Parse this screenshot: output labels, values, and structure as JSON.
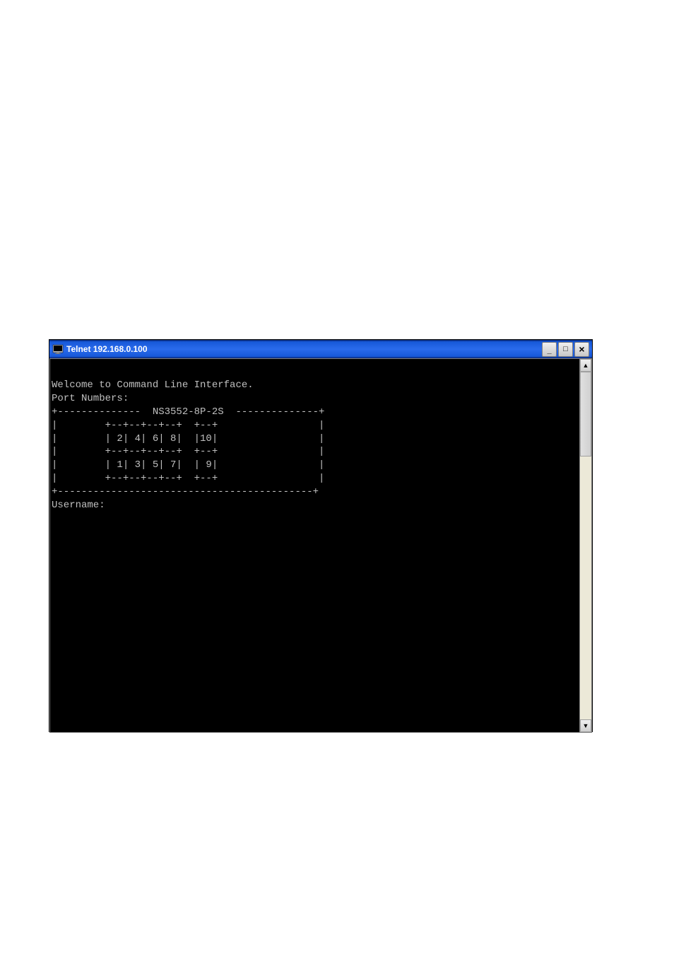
{
  "window": {
    "title": "Telnet 192.168.0.100",
    "controls": {
      "minimize": "─",
      "maximize": "□",
      "close": "×"
    }
  },
  "terminal": {
    "line1": "Welcome to Command Line Interface.",
    "line2": "Port Numbers:",
    "line3": "",
    "line4": "+--------------  NS3552-8P-2S  --------------+",
    "line5": "|        +--+--+--+--+  +--+                 |",
    "line6": "|        | 2| 4| 6| 8|  |10|                 |",
    "line7": "|        +--+--+--+--+  +--+                 |",
    "line8": "|        | 1| 3| 5| 7|  | 9|                 |",
    "line9": "|        +--+--+--+--+  +--+                 |",
    "line10": "+-------------------------------------------+",
    "line11": "",
    "prompt_label": "Username: ",
    "prompt_value": ""
  },
  "scroll": {
    "up": "▲",
    "down": "▼"
  }
}
